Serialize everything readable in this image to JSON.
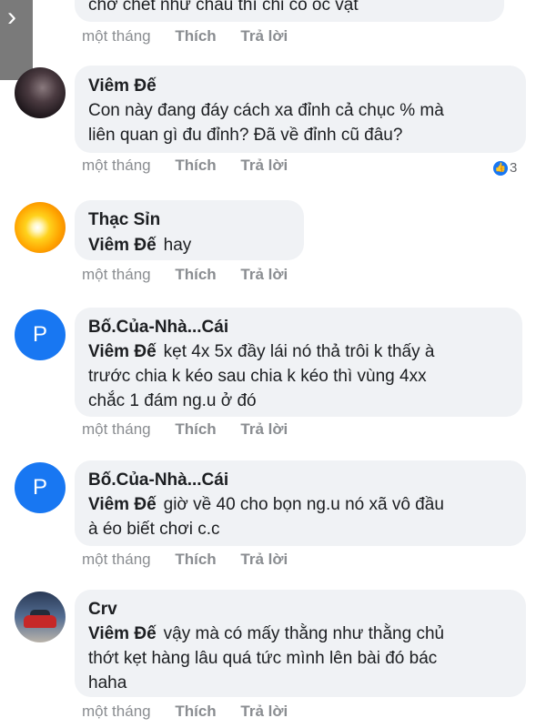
{
  "comments": [
    {
      "author": "",
      "text_lines": [
        "chờ chết như cháu thì chỉ có ốc vặt"
      ],
      "time": "một tháng",
      "like": "Thích",
      "reply": "Trả lời"
    },
    {
      "author": "Viêm Đế",
      "avatar": "dark-portrait",
      "text_lines": [
        "Con này đang đáy cách xa đỉnh cả chục % mà",
        "liên quan gì đu đỉnh? Đã về đỉnh cũ đâu?"
      ],
      "time": "một tháng",
      "like": "Thích",
      "reply": "Trả lời",
      "reaction": {
        "icon": "like-icon",
        "count": "3"
      }
    },
    {
      "author": "Thạc Sỉn",
      "avatar": "sun",
      "mention": "Viêm Đế",
      "text_lines": [
        "hay"
      ],
      "time": "một tháng",
      "like": "Thích",
      "reply": "Trả lời"
    },
    {
      "author": "Bố.Của-Nhà...Cái",
      "avatar": "P",
      "mention": "Viêm Đế",
      "text_lines": [
        "kẹt 4x 5x đầy lái nó thả trôi k thấy à",
        "trước chia k kéo sau chia k kéo thì vùng 4xx",
        "chắc 1 đám ng.u ở đó"
      ],
      "time": "một tháng",
      "like": "Thích",
      "reply": "Trả lời"
    },
    {
      "author": "Bố.Của-Nhà...Cái",
      "avatar": "P",
      "mention": "Viêm Đế",
      "text_lines": [
        "giờ về 40 cho bọn ng.u nó xã vô đầu",
        "à éo biết chơi c.c"
      ],
      "time": "một tháng",
      "like": "Thích",
      "reply": "Trả lời"
    },
    {
      "author": "Crv",
      "avatar": "car",
      "mention": "Viêm Đế",
      "text_lines": [
        "vậy mà có mấy thằng như thằng chủ",
        "thớt kẹt hàng lâu quá tức mình lên bài đó bác",
        "haha"
      ],
      "time": "một tháng",
      "like": "Thích",
      "reply": "Trả lời"
    }
  ]
}
